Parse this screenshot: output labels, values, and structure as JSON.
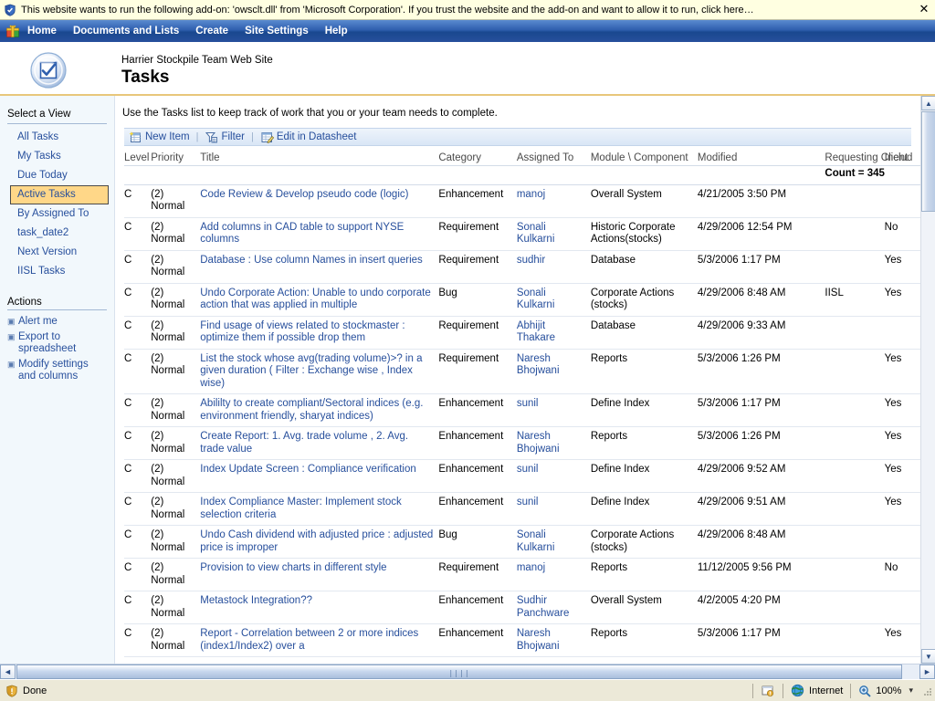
{
  "infobar": {
    "icon": "shield-icon",
    "message": "This website wants to run the following add-on: 'owsclt.dll' from 'Microsoft Corporation'. If you trust the website and the add-on and want to allow it to run, click here…",
    "close_label": "✕"
  },
  "topnav": {
    "logo_icon": "site-logo-icon",
    "items": [
      {
        "label": "Home",
        "name": "home"
      },
      {
        "label": "Documents and Lists",
        "name": "documents-and-lists"
      },
      {
        "label": "Create",
        "name": "create"
      },
      {
        "label": "Site Settings",
        "name": "site-settings"
      },
      {
        "label": "Help",
        "name": "help"
      }
    ]
  },
  "banner": {
    "logo_icon": "tasks-list-icon",
    "site_name": "Harrier Stockpile Team Web Site",
    "page_title": "Tasks"
  },
  "sidebar": {
    "views_heading": "Select a View",
    "views": [
      {
        "label": "All Tasks",
        "selected": false
      },
      {
        "label": "My Tasks",
        "selected": false
      },
      {
        "label": "Due Today",
        "selected": false
      },
      {
        "label": "Active Tasks",
        "selected": true
      },
      {
        "label": "By Assigned To",
        "selected": false
      },
      {
        "label": "task_date2",
        "selected": false
      },
      {
        "label": "Next Version",
        "selected": false
      },
      {
        "label": "IISL Tasks",
        "selected": false
      }
    ],
    "actions_heading": "Actions",
    "actions": [
      {
        "label": "Alert me",
        "icon": "bullet-icon"
      },
      {
        "label": "Export to spreadsheet",
        "icon": "bullet-icon"
      },
      {
        "label": "Modify settings and columns",
        "icon": "bullet-icon"
      }
    ]
  },
  "main": {
    "description": "Use the Tasks list to keep track of work that you or your team needs to complete.",
    "toolbar": {
      "new_item": "New Item",
      "new_item_icon": "new-item-icon",
      "filter": "Filter",
      "filter_icon": "filter-icon",
      "edit_datasheet": "Edit in Datasheet",
      "edit_datasheet_icon": "datasheet-icon",
      "separator": "|"
    },
    "table": {
      "headers": [
        "Level",
        "Priority",
        "Title",
        "Category",
        "Assigned To",
        "Module \\ Component",
        "Modified",
        "Requesting Client",
        "Includ"
      ],
      "count_label": "Count = 345",
      "rows": [
        {
          "level": "C",
          "priority": "(2) Normal",
          "title": "Code Review & Develop pseudo code (logic)",
          "category": "Enhancement",
          "assigned": "manoj",
          "module": "Overall System",
          "modified": "4/21/2005 3:50 PM",
          "client": "",
          "included": ""
        },
        {
          "level": "C",
          "priority": "(2) Normal",
          "title": "Add columns in CAD table to support NYSE columns",
          "category": "Requirement",
          "assigned": "Sonali Kulkarni",
          "module": "Historic Corporate Actions(stocks)",
          "modified": "4/29/2006 12:54 PM",
          "client": "",
          "included": "No"
        },
        {
          "level": "C",
          "priority": "(2) Normal",
          "title": "Database : Use column Names in insert queries",
          "category": "Requirement",
          "assigned": "sudhir",
          "module": "Database",
          "modified": "5/3/2006 1:17 PM",
          "client": "",
          "included": "Yes"
        },
        {
          "level": "C",
          "priority": "(2) Normal",
          "title": "Undo Corporate Action: Unable to undo corporate action that was applied in multiple",
          "category": "Bug",
          "assigned": "Sonali Kulkarni",
          "module": "Corporate Actions (stocks)",
          "modified": "4/29/2006 8:48 AM",
          "client": "IISL",
          "included": "Yes"
        },
        {
          "level": "C",
          "priority": "(2) Normal",
          "title": "Find usage of views related to stockmaster : optimize them if possible drop them",
          "category": "Requirement",
          "assigned": "Abhijit Thakare",
          "module": "Database",
          "modified": "4/29/2006 9:33 AM",
          "client": "",
          "included": ""
        },
        {
          "level": "C",
          "priority": "(2) Normal",
          "title": "List the stock whose avg(trading volume)>? in a given duration ( Filter : Exchange wise , Index wise)",
          "category": "Requirement",
          "assigned": "Naresh Bhojwani",
          "module": "Reports",
          "modified": "5/3/2006 1:26 PM",
          "client": "",
          "included": "Yes"
        },
        {
          "level": "C",
          "priority": "(2) Normal",
          "title": "Abililty to create compliant/Sectoral indices (e.g. environment friendly, sharyat indices)",
          "category": "Enhancement",
          "assigned": "sunil",
          "module": "Define Index",
          "modified": "5/3/2006 1:17 PM",
          "client": "",
          "included": "Yes"
        },
        {
          "level": "C",
          "priority": "(2) Normal",
          "title": "Create Report: 1. Avg. trade volume , 2. Avg. trade value",
          "category": "Enhancement",
          "assigned": "Naresh Bhojwani",
          "module": "Reports",
          "modified": "5/3/2006 1:26 PM",
          "client": "",
          "included": "Yes"
        },
        {
          "level": "C",
          "priority": "(2) Normal",
          "title": "Index Update Screen : Compliance verification",
          "category": "Enhancement",
          "assigned": "sunil",
          "module": "Define Index",
          "modified": "4/29/2006 9:52 AM",
          "client": "",
          "included": "Yes"
        },
        {
          "level": "C",
          "priority": "(2) Normal",
          "title": "Index Compliance Master: Implement stock selection criteria",
          "category": "Enhancement",
          "assigned": "sunil",
          "module": "Define Index",
          "modified": "4/29/2006 9:51 AM",
          "client": "",
          "included": "Yes"
        },
        {
          "level": "C",
          "priority": "(2) Normal",
          "title": "Undo Cash dividend with adjusted price : adjusted price is improper",
          "category": "Bug",
          "assigned": "Sonali Kulkarni",
          "module": "Corporate Actions (stocks)",
          "modified": "4/29/2006 8:48 AM",
          "client": "",
          "included": ""
        },
        {
          "level": "C",
          "priority": "(2) Normal",
          "title": "Provision to view charts in different style",
          "category": "Requirement",
          "assigned": "manoj",
          "module": "Reports",
          "modified": "11/12/2005 9:56 PM",
          "client": "",
          "included": "No"
        },
        {
          "level": "C",
          "priority": "(2) Normal",
          "title": "Metastock Integration??",
          "category": "Enhancement",
          "assigned": "Sudhir Panchware",
          "module": "Overall System",
          "modified": "4/2/2005 4:20 PM",
          "client": "",
          "included": ""
        },
        {
          "level": "C",
          "priority": "(2) Normal",
          "title": "Report - Correlation between 2 or more indices (index1/Index2) over a",
          "category": "Enhancement",
          "assigned": "Naresh Bhojwani",
          "module": "Reports",
          "modified": "5/3/2006 1:17 PM",
          "client": "",
          "included": "Yes"
        }
      ]
    }
  },
  "scrollbars": {
    "vertical_up": "▲",
    "vertical_down": "▼",
    "horizontal_left": "◄",
    "horizontal_right": "►",
    "grip": "||||"
  },
  "statusbar": {
    "status_icon": "security-shield-icon",
    "status_text": "Done",
    "zone_icon": "internet-globe-icon",
    "zone_text": "Internet",
    "protect_icon": "protected-mode-icon",
    "zoom_icon": "zoom-magnifier-icon",
    "zoom_level": "100%",
    "zoom_caret": "▾"
  },
  "colors": {
    "nav_blue": "#274f9c",
    "link_blue": "#274f9c",
    "selected_view_bg": "#ffd788",
    "infobar_bg": "#ffffe1",
    "sidebar_bg": "#f2f8fc",
    "banner_rule": "#e8c77b",
    "statusbar_bg": "#ece9d8"
  }
}
